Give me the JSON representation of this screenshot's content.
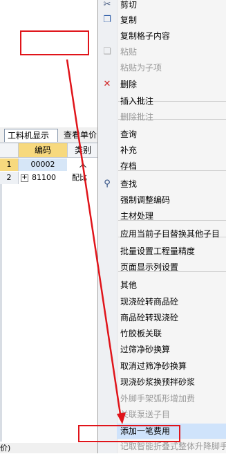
{
  "left": {
    "tabs": [
      "工料机显示",
      "查看单价"
    ],
    "grid": {
      "headers": [
        "编码",
        "类别"
      ],
      "rows": [
        {
          "num": "1",
          "code": "00002",
          "type": "人"
        },
        {
          "num": "2",
          "expand": "+",
          "code": "81100",
          "type": "配比"
        }
      ]
    },
    "status_text": "价)"
  },
  "menu": {
    "items": [
      {
        "label": "剪切",
        "icon": "scissors-icon",
        "disabled": false
      },
      {
        "label": "复制",
        "icon": "copy-icon",
        "disabled": false
      },
      {
        "label": "复制格子内容",
        "disabled": false
      },
      {
        "label": "粘贴",
        "icon": "paste-icon",
        "disabled": true
      },
      {
        "label": "粘贴为子项",
        "disabled": true
      },
      {
        "label": "删除",
        "icon": "delete-x-icon",
        "disabled": false
      },
      {
        "label": "插入批注",
        "disabled": false
      },
      {
        "label": "删除批注",
        "disabled": true
      },
      {
        "label": "查询",
        "disabled": false
      },
      {
        "label": "补充",
        "disabled": false
      },
      {
        "label": "存档",
        "disabled": false
      },
      {
        "label": "查找",
        "icon": "binoculars-icon",
        "disabled": false
      },
      {
        "label": "强制调整编码",
        "disabled": false
      },
      {
        "label": "主材处理",
        "disabled": false
      },
      {
        "label": "应用当前子目替换其他子目",
        "disabled": false
      },
      {
        "label": "批量设置工程量精度",
        "disabled": false
      },
      {
        "label": "页面显示列设置",
        "disabled": false
      },
      {
        "label": "其他",
        "disabled": false
      },
      {
        "label": "现浇砼转商品砼",
        "disabled": false
      },
      {
        "label": "商品砼转现浇砼",
        "disabled": false
      },
      {
        "label": "竹胶板关联",
        "disabled": false
      },
      {
        "label": "过筛净砂换算",
        "disabled": false
      },
      {
        "label": "取消过筛净砂换算",
        "disabled": false
      },
      {
        "label": "现浇砂浆换预拌砂浆",
        "disabled": false
      },
      {
        "label": "外脚手架弧形增加费",
        "disabled": true
      },
      {
        "label": "关联泵送子目",
        "disabled": true
      },
      {
        "label": "添加一笔费用",
        "disabled": false
      },
      {
        "label": "记取智能折叠式整体升降脚手",
        "disabled": true
      }
    ]
  },
  "colors": {
    "annotation_red": "#e0141a",
    "highlight": "#cfe3fb"
  }
}
